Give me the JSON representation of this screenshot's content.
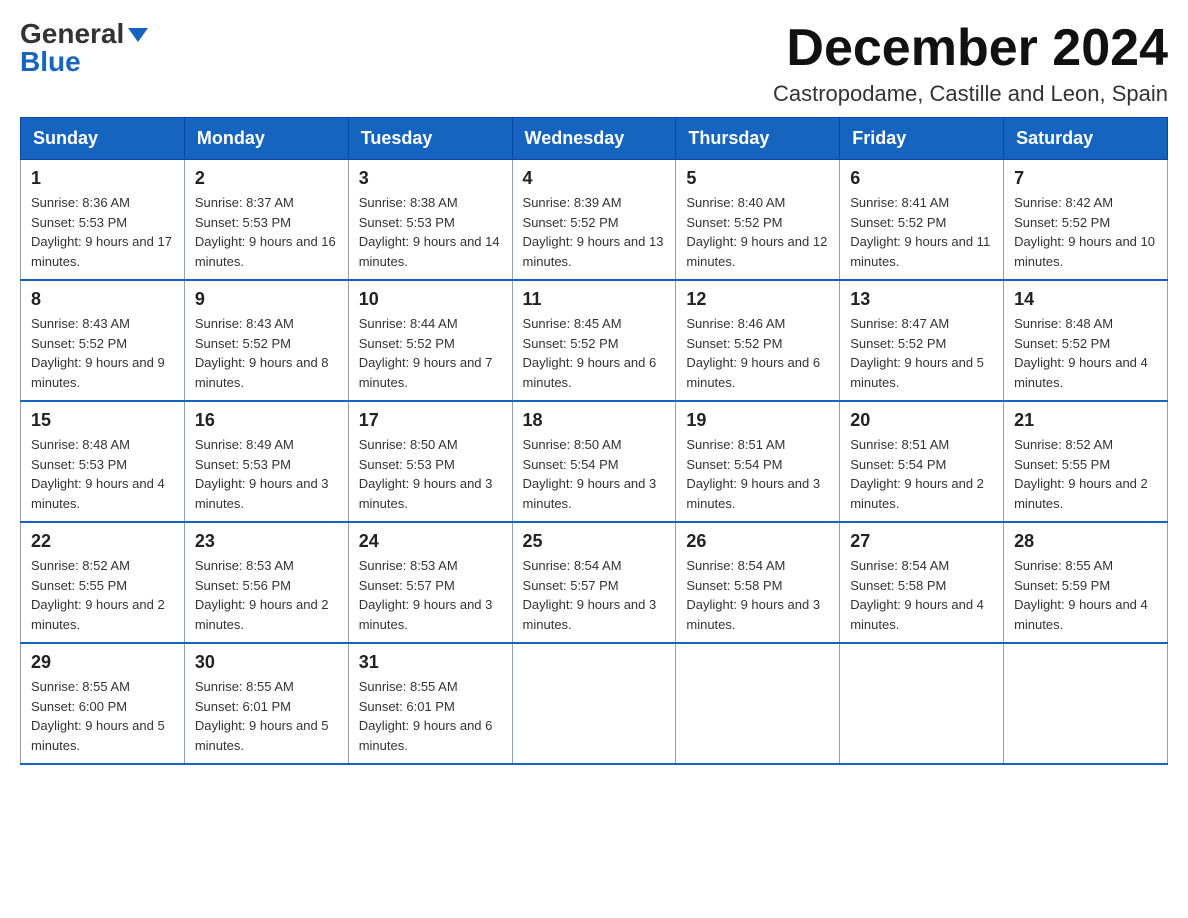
{
  "header": {
    "logo_general": "General",
    "logo_blue": "Blue",
    "month_title": "December 2024",
    "location": "Castropodame, Castille and Leon, Spain"
  },
  "weekdays": [
    "Sunday",
    "Monday",
    "Tuesday",
    "Wednesday",
    "Thursday",
    "Friday",
    "Saturday"
  ],
  "weeks": [
    [
      {
        "day": "1",
        "sunrise": "8:36 AM",
        "sunset": "5:53 PM",
        "daylight": "9 hours and 17 minutes."
      },
      {
        "day": "2",
        "sunrise": "8:37 AM",
        "sunset": "5:53 PM",
        "daylight": "9 hours and 16 minutes."
      },
      {
        "day": "3",
        "sunrise": "8:38 AM",
        "sunset": "5:53 PM",
        "daylight": "9 hours and 14 minutes."
      },
      {
        "day": "4",
        "sunrise": "8:39 AM",
        "sunset": "5:52 PM",
        "daylight": "9 hours and 13 minutes."
      },
      {
        "day": "5",
        "sunrise": "8:40 AM",
        "sunset": "5:52 PM",
        "daylight": "9 hours and 12 minutes."
      },
      {
        "day": "6",
        "sunrise": "8:41 AM",
        "sunset": "5:52 PM",
        "daylight": "9 hours and 11 minutes."
      },
      {
        "day": "7",
        "sunrise": "8:42 AM",
        "sunset": "5:52 PM",
        "daylight": "9 hours and 10 minutes."
      }
    ],
    [
      {
        "day": "8",
        "sunrise": "8:43 AM",
        "sunset": "5:52 PM",
        "daylight": "9 hours and 9 minutes."
      },
      {
        "day": "9",
        "sunrise": "8:43 AM",
        "sunset": "5:52 PM",
        "daylight": "9 hours and 8 minutes."
      },
      {
        "day": "10",
        "sunrise": "8:44 AM",
        "sunset": "5:52 PM",
        "daylight": "9 hours and 7 minutes."
      },
      {
        "day": "11",
        "sunrise": "8:45 AM",
        "sunset": "5:52 PM",
        "daylight": "9 hours and 6 minutes."
      },
      {
        "day": "12",
        "sunrise": "8:46 AM",
        "sunset": "5:52 PM",
        "daylight": "9 hours and 6 minutes."
      },
      {
        "day": "13",
        "sunrise": "8:47 AM",
        "sunset": "5:52 PM",
        "daylight": "9 hours and 5 minutes."
      },
      {
        "day": "14",
        "sunrise": "8:48 AM",
        "sunset": "5:52 PM",
        "daylight": "9 hours and 4 minutes."
      }
    ],
    [
      {
        "day": "15",
        "sunrise": "8:48 AM",
        "sunset": "5:53 PM",
        "daylight": "9 hours and 4 minutes."
      },
      {
        "day": "16",
        "sunrise": "8:49 AM",
        "sunset": "5:53 PM",
        "daylight": "9 hours and 3 minutes."
      },
      {
        "day": "17",
        "sunrise": "8:50 AM",
        "sunset": "5:53 PM",
        "daylight": "9 hours and 3 minutes."
      },
      {
        "day": "18",
        "sunrise": "8:50 AM",
        "sunset": "5:54 PM",
        "daylight": "9 hours and 3 minutes."
      },
      {
        "day": "19",
        "sunrise": "8:51 AM",
        "sunset": "5:54 PM",
        "daylight": "9 hours and 3 minutes."
      },
      {
        "day": "20",
        "sunrise": "8:51 AM",
        "sunset": "5:54 PM",
        "daylight": "9 hours and 2 minutes."
      },
      {
        "day": "21",
        "sunrise": "8:52 AM",
        "sunset": "5:55 PM",
        "daylight": "9 hours and 2 minutes."
      }
    ],
    [
      {
        "day": "22",
        "sunrise": "8:52 AM",
        "sunset": "5:55 PM",
        "daylight": "9 hours and 2 minutes."
      },
      {
        "day": "23",
        "sunrise": "8:53 AM",
        "sunset": "5:56 PM",
        "daylight": "9 hours and 2 minutes."
      },
      {
        "day": "24",
        "sunrise": "8:53 AM",
        "sunset": "5:57 PM",
        "daylight": "9 hours and 3 minutes."
      },
      {
        "day": "25",
        "sunrise": "8:54 AM",
        "sunset": "5:57 PM",
        "daylight": "9 hours and 3 minutes."
      },
      {
        "day": "26",
        "sunrise": "8:54 AM",
        "sunset": "5:58 PM",
        "daylight": "9 hours and 3 minutes."
      },
      {
        "day": "27",
        "sunrise": "8:54 AM",
        "sunset": "5:58 PM",
        "daylight": "9 hours and 4 minutes."
      },
      {
        "day": "28",
        "sunrise": "8:55 AM",
        "sunset": "5:59 PM",
        "daylight": "9 hours and 4 minutes."
      }
    ],
    [
      {
        "day": "29",
        "sunrise": "8:55 AM",
        "sunset": "6:00 PM",
        "daylight": "9 hours and 5 minutes."
      },
      {
        "day": "30",
        "sunrise": "8:55 AM",
        "sunset": "6:01 PM",
        "daylight": "9 hours and 5 minutes."
      },
      {
        "day": "31",
        "sunrise": "8:55 AM",
        "sunset": "6:01 PM",
        "daylight": "9 hours and 6 minutes."
      },
      null,
      null,
      null,
      null
    ]
  ]
}
